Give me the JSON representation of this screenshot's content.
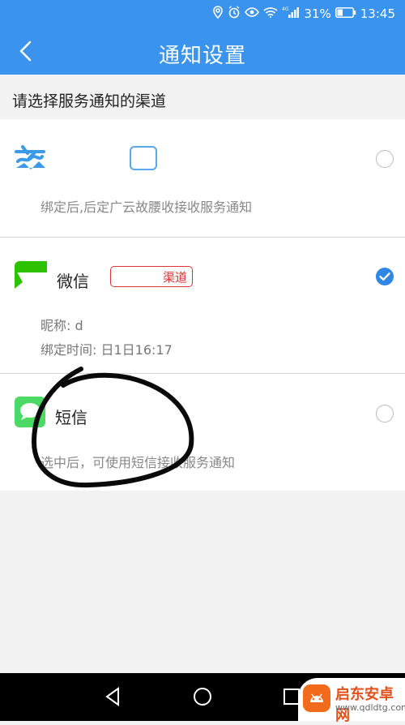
{
  "status_bar": {
    "battery_percent": "31%",
    "time": "13:45",
    "network": "4G"
  },
  "header": {
    "title": "通知设置"
  },
  "section": {
    "prompt": "请选择服务通知的渠道"
  },
  "channels": [
    {
      "name": "",
      "badge": "",
      "desc": "绑定后,后定广云故腰收接收服务通知",
      "selected": false
    },
    {
      "name": "微信",
      "badge": "渠道",
      "nickname_line": "昵称:  d",
      "bind_time_line": "绑定时间: 日1日16:17",
      "selected": true
    },
    {
      "name": "短信",
      "desc": "选中后，可使用短信接收服务通知",
      "selected": false
    }
  ],
  "watermark": {
    "brand": "启东安卓网",
    "url": "www.qdldtg.com"
  },
  "colors": {
    "header_blue": "#3a93ec",
    "radio_checked": "#2e86e6",
    "badge_red": "#d33",
    "sms_green": "#4cd964",
    "wechat_green": "#2dc100"
  }
}
